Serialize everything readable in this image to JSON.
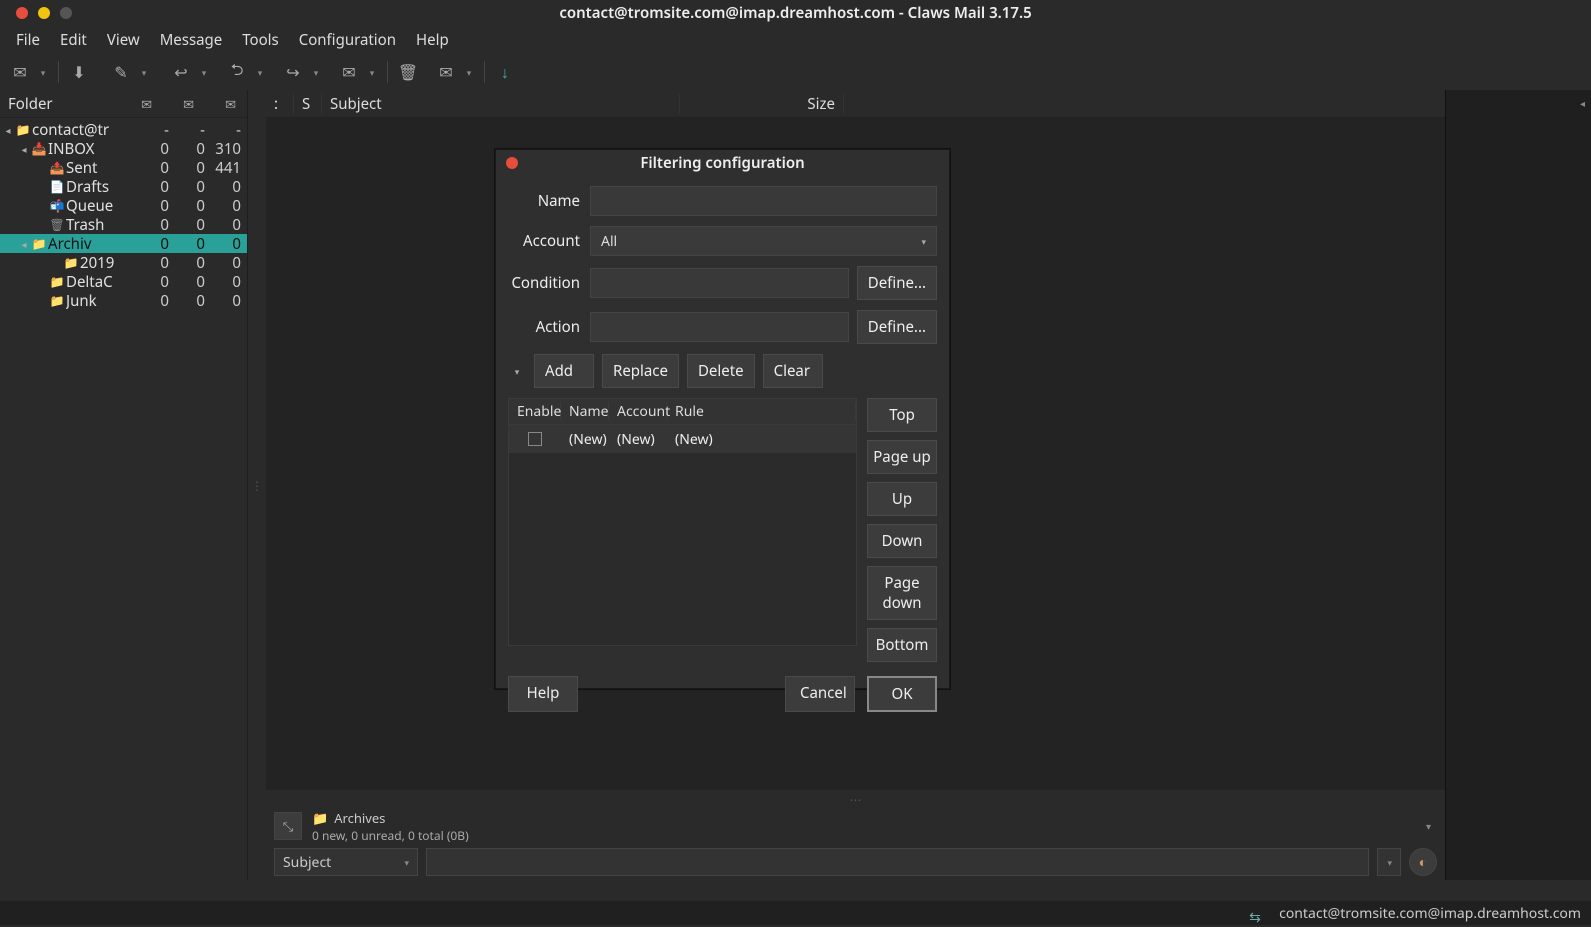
{
  "window": {
    "title": "contact@tromsite.com@imap.dreamhost.com - Claws Mail 3.17.5"
  },
  "menu": [
    "File",
    "Edit",
    "View",
    "Message",
    "Tools",
    "Configuration",
    "Help"
  ],
  "toolbar_icons": [
    "compose",
    "|",
    "receive",
    "send",
    "▾",
    "reply",
    "▾",
    "replyall",
    "▾",
    "forward",
    "▾",
    "mark",
    "▾",
    "|",
    "trash",
    "junk",
    "▾",
    "|",
    "refresh"
  ],
  "folder_header": {
    "label": "Folder"
  },
  "folders": [
    {
      "indent": 0,
      "exp": "◂",
      "icon": "📁",
      "name": "contact@tr",
      "c1": "-",
      "c2": "-",
      "c3": "-",
      "sel": false
    },
    {
      "indent": 1,
      "exp": "◂",
      "icon": "📥",
      "name": "INBOX",
      "c1": "0",
      "c2": "0",
      "c3": "310",
      "sel": false
    },
    {
      "indent": 2,
      "exp": "",
      "icon": "📤",
      "name": "Sent",
      "c1": "0",
      "c2": "0",
      "c3": "441",
      "sel": false
    },
    {
      "indent": 2,
      "exp": "",
      "icon": "📄",
      "name": "Drafts",
      "c1": "0",
      "c2": "0",
      "c3": "0",
      "sel": false
    },
    {
      "indent": 2,
      "exp": "",
      "icon": "📬",
      "name": "Queue",
      "c1": "0",
      "c2": "0",
      "c3": "0",
      "sel": false
    },
    {
      "indent": 2,
      "exp": "",
      "icon": "🗑",
      "name": "Trash",
      "c1": "0",
      "c2": "0",
      "c3": "0",
      "sel": false
    },
    {
      "indent": 1,
      "exp": "◂",
      "icon": "📁",
      "name": "Archiv",
      "c1": "0",
      "c2": "0",
      "c3": "0",
      "sel": true
    },
    {
      "indent": 3,
      "exp": "",
      "icon": "📁",
      "name": "2019",
      "c1": "0",
      "c2": "0",
      "c3": "0",
      "sel": false
    },
    {
      "indent": 2,
      "exp": "",
      "icon": "📁",
      "name": "DeltaC",
      "c1": "0",
      "c2": "0",
      "c3": "0",
      "sel": false
    },
    {
      "indent": 2,
      "exp": "",
      "icon": "📁",
      "name": "Junk",
      "c1": "0",
      "c2": "0",
      "c3": "0",
      "sel": false
    }
  ],
  "msg_cols": {
    "status": "S",
    "subject": "Subject",
    "size": "Size"
  },
  "preview": {
    "folder": "Archives",
    "status": "0 new, 0 unread, 0 total (0B)"
  },
  "subject_filter": {
    "label": "Subject"
  },
  "statusbar": {
    "account": "contact@tromsite.com@imap.dreamhost.com"
  },
  "dialog": {
    "title": "Filtering configuration",
    "labels": {
      "name": "Name",
      "account": "Account",
      "condition": "Condition",
      "action": "Action"
    },
    "account_value": "All",
    "define": "Define...",
    "action_buttons": {
      "add": "Add",
      "replace": "Replace",
      "delete": "Delete",
      "clear": "Clear"
    },
    "list_headers": {
      "enable": "Enable",
      "name": "Name",
      "account": "Account",
      "rule": "Rule"
    },
    "list_row": {
      "name": "(New)",
      "account": "(New)",
      "rule": "(New)"
    },
    "order": {
      "top": "Top",
      "pageup": "Page up",
      "up": "Up",
      "down": "Down",
      "pagedown": "Page down",
      "bottom": "Bottom"
    },
    "footer": {
      "help": "Help",
      "cancel": "Cancel",
      "ok": "OK"
    }
  }
}
